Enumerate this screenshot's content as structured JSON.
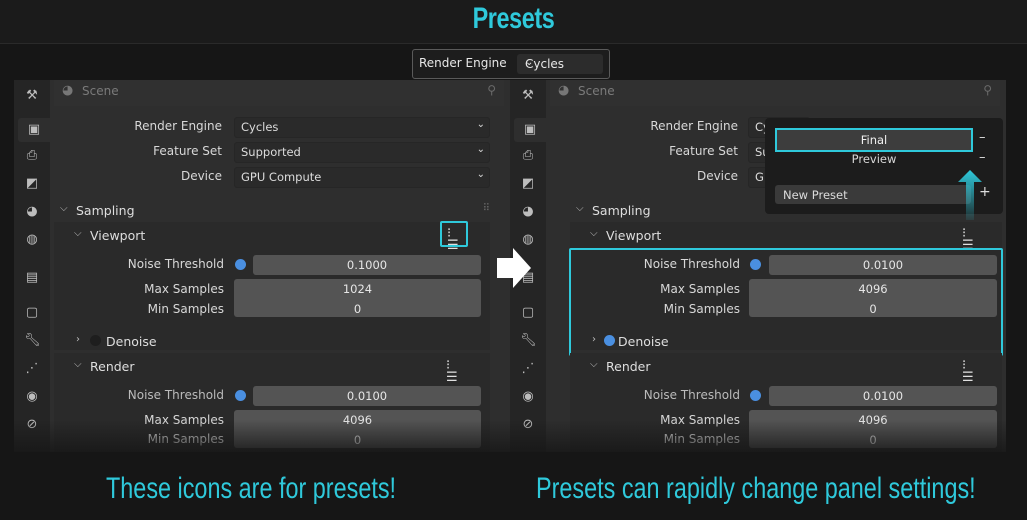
{
  "title": "Presets",
  "render_engine_box": {
    "label": "Render Engine",
    "value": "Cycles"
  },
  "scene": "Scene",
  "props": {
    "render_engine_label": "Render Engine",
    "render_engine_value": "Cycles",
    "feature_set_label": "Feature Set",
    "feature_set_value": "Supported",
    "device_label": "Device",
    "device_value": "GPU Compute"
  },
  "sections": {
    "sampling": "Sampling",
    "viewport": "Viewport",
    "render": "Render",
    "denoise": "Denoise"
  },
  "labels": {
    "noise_threshold": "Noise Threshold",
    "max_samples": "Max Samples",
    "min_samples": "Min Samples"
  },
  "left": {
    "viewport": {
      "noise_threshold": "0.1000",
      "max_samples": "1024",
      "min_samples": "0"
    },
    "render": {
      "noise_threshold": "0.0100",
      "max_samples": "4096",
      "min_samples": "0"
    }
  },
  "right": {
    "render_engine_value": "Cy",
    "feature_set_value": "Su",
    "device_value": "GI",
    "viewport": {
      "noise_threshold": "0.0100",
      "max_samples": "4096",
      "min_samples": "0"
    },
    "render": {
      "noise_threshold": "0.0100",
      "max_samples": "4096",
      "min_samples": "0"
    }
  },
  "popup": {
    "items": [
      "Final",
      "Preview"
    ],
    "new_preset": "New Preset",
    "remove": "–",
    "add": "+"
  },
  "captions": {
    "left": "These icons are for presets!",
    "right": "Presets can rapidly change panel settings!"
  },
  "colors": {
    "accent": "#2fc9db",
    "toggle": "#4a8fe0"
  },
  "icons": [
    "tool-icon",
    "render-icon",
    "output-icon",
    "view-layer-icon",
    "scene-icon",
    "world-icon",
    "collection-icon",
    "object-icon",
    "modifier-icon",
    "particles-icon",
    "physics-icon",
    "constraints-icon",
    "presets-icon",
    "pin-icon"
  ]
}
